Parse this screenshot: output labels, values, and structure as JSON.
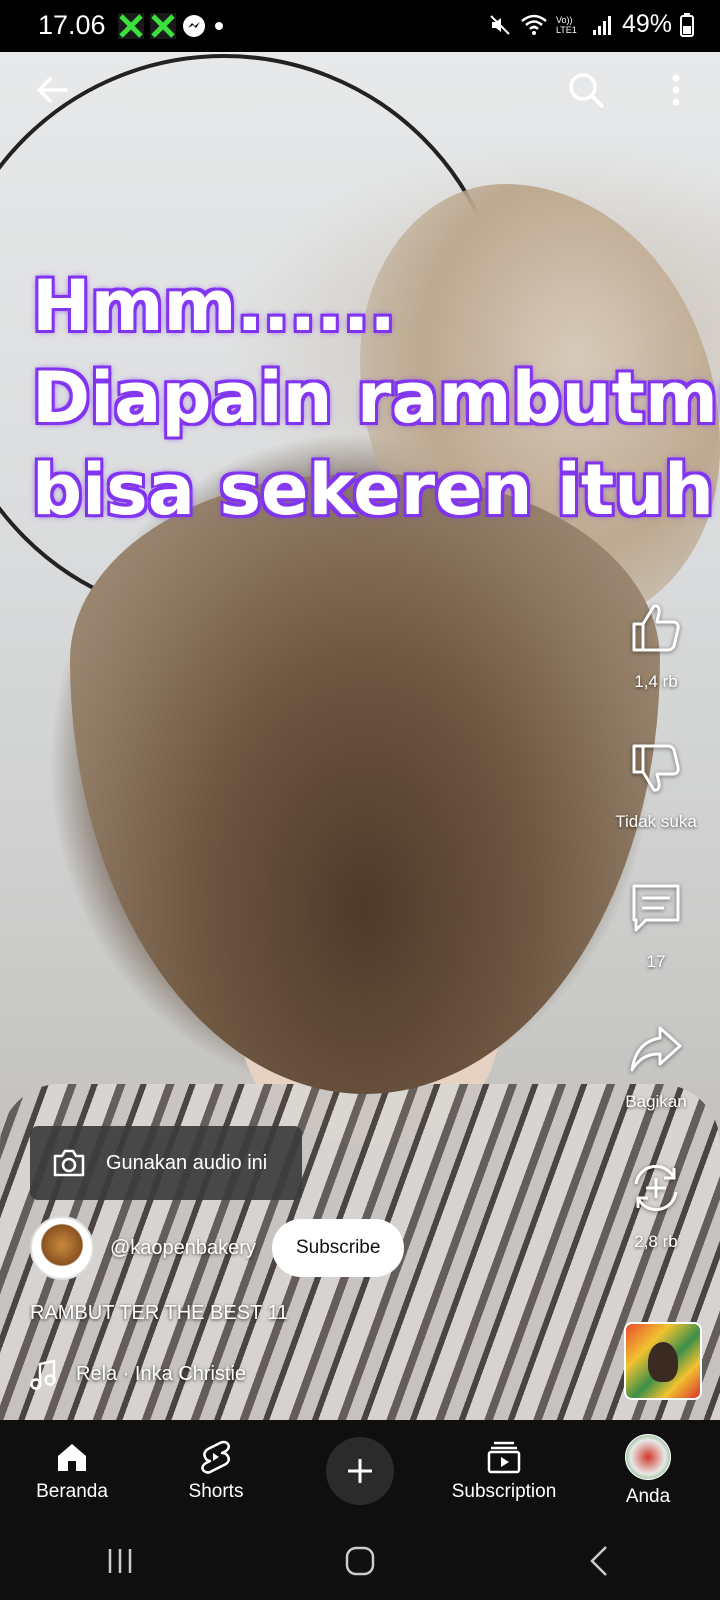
{
  "status_bar": {
    "time": "17.06",
    "battery": "49%",
    "network_label": "Vo)) LTE1",
    "icons": [
      "app-x-icon",
      "app-x-icon",
      "messenger-icon",
      "dot-icon",
      "mute-icon",
      "wifi-icon",
      "signal-icon",
      "battery-icon"
    ]
  },
  "top_bar": {
    "icons": [
      "back-arrow-icon",
      "search-icon",
      "more-vert-icon"
    ]
  },
  "overlay_text": {
    "line1": "Hmm......",
    "line2": "Diapain rambutmu",
    "line3": "bisa sekeren ituh",
    "color": "#ffffff",
    "glow_color": "#7b2ff0"
  },
  "actions": {
    "like_count": "1,4 rb",
    "dislike_label": "Tidak suka",
    "comment_count": "17",
    "share_label": "Bagikan",
    "remix_count": "2,8 rb"
  },
  "audio_chip": {
    "label": "Gunakan audio ini",
    "icon": "camera-icon"
  },
  "channel": {
    "handle": "@kaopenbakery",
    "subscribe_label": "Subscribe"
  },
  "video": {
    "title": "RAMBUT TER THE BEST 11",
    "music": "Rela · Inka Christie"
  },
  "bottom_nav": {
    "items": [
      {
        "label": "Beranda",
        "icon": "home-icon"
      },
      {
        "label": "Shorts",
        "icon": "shorts-icon"
      },
      {
        "label": "",
        "icon": "plus-icon"
      },
      {
        "label": "Subscription",
        "icon": "subscriptions-icon"
      },
      {
        "label": "Anda",
        "icon": "avatar-icon"
      }
    ]
  },
  "system_nav": {
    "icons": [
      "recents-icon",
      "home-circle-icon",
      "back-chevron-icon"
    ]
  },
  "colors": {
    "nav_background": "#0f0f0f",
    "subscribe_bg": "#ffffff",
    "overlay_glow": "#7b2ff0"
  }
}
